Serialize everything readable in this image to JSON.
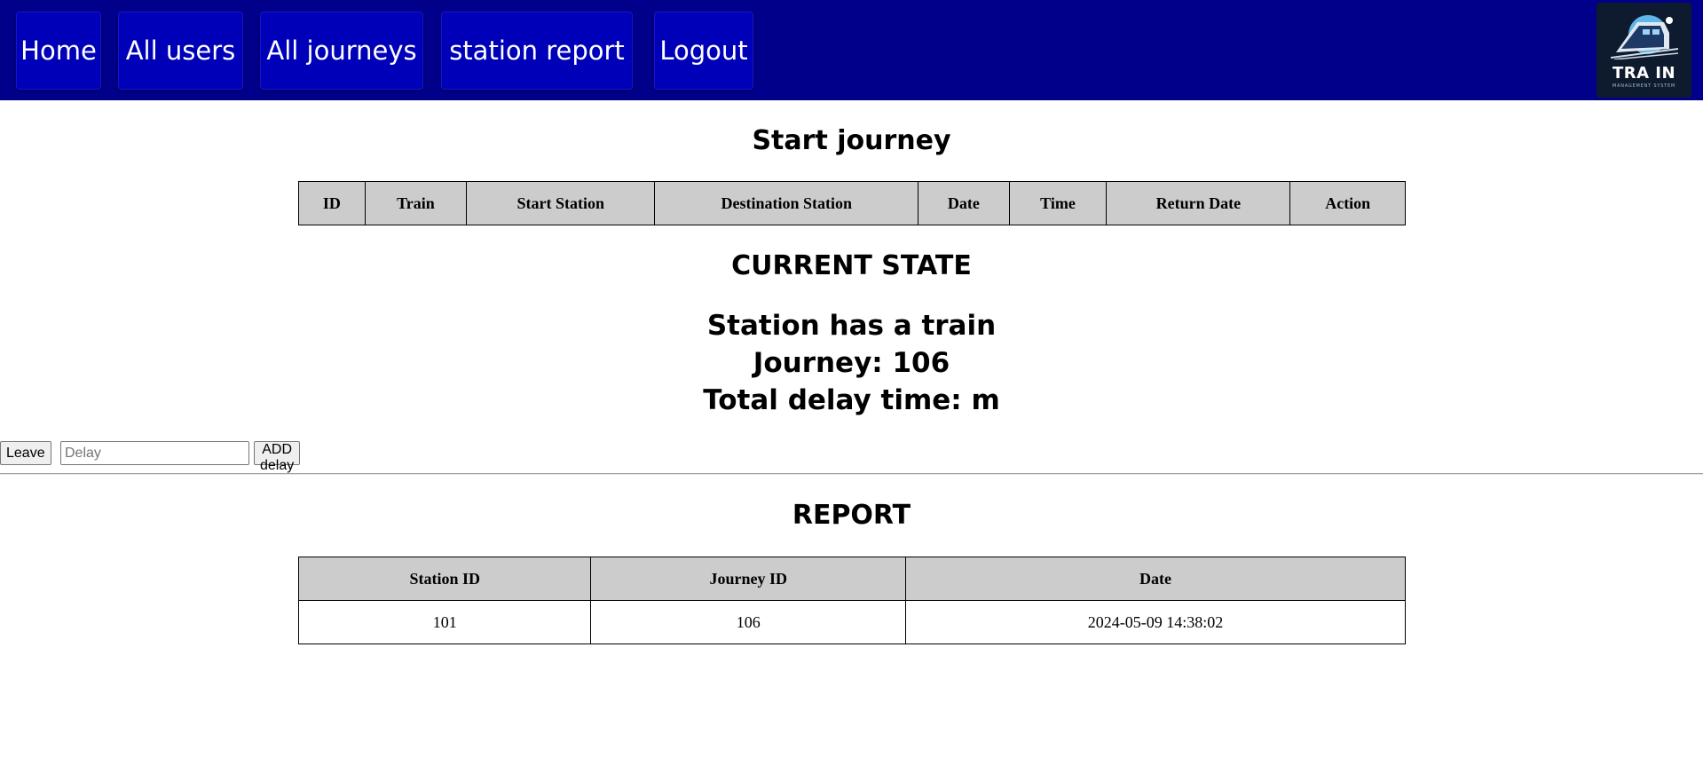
{
  "nav": {
    "items": [
      {
        "label": "Home"
      },
      {
        "label": "All users"
      },
      {
        "label": "All journeys"
      },
      {
        "label": "station report"
      },
      {
        "label": "Logout"
      }
    ],
    "logo": {
      "title": "TRA IN",
      "subtitle": "MANAGEMENT SYSTEM"
    }
  },
  "start_journey": {
    "heading": "Start journey",
    "columns": [
      "ID",
      "Train",
      "Start Station",
      "Destination Station",
      "Date",
      "Time",
      "Return Date",
      "Action"
    ]
  },
  "current_state": {
    "heading": "CURRENT STATE",
    "status": "Station has a train",
    "journey": "Journey: 106",
    "delay": "Total delay time: m"
  },
  "controls": {
    "leave_label": "Leave",
    "delay_placeholder": "Delay",
    "add_delay_label": "ADD delay"
  },
  "report": {
    "heading": "REPORT",
    "columns": [
      "Station ID",
      "Journey ID",
      "Date"
    ],
    "rows": [
      [
        "101",
        "106",
        "2024-05-09 14:38:02"
      ]
    ]
  },
  "colors": {
    "navbar": "#00008b",
    "nav_button": "#0000b8",
    "table_header": "#cccccc"
  }
}
